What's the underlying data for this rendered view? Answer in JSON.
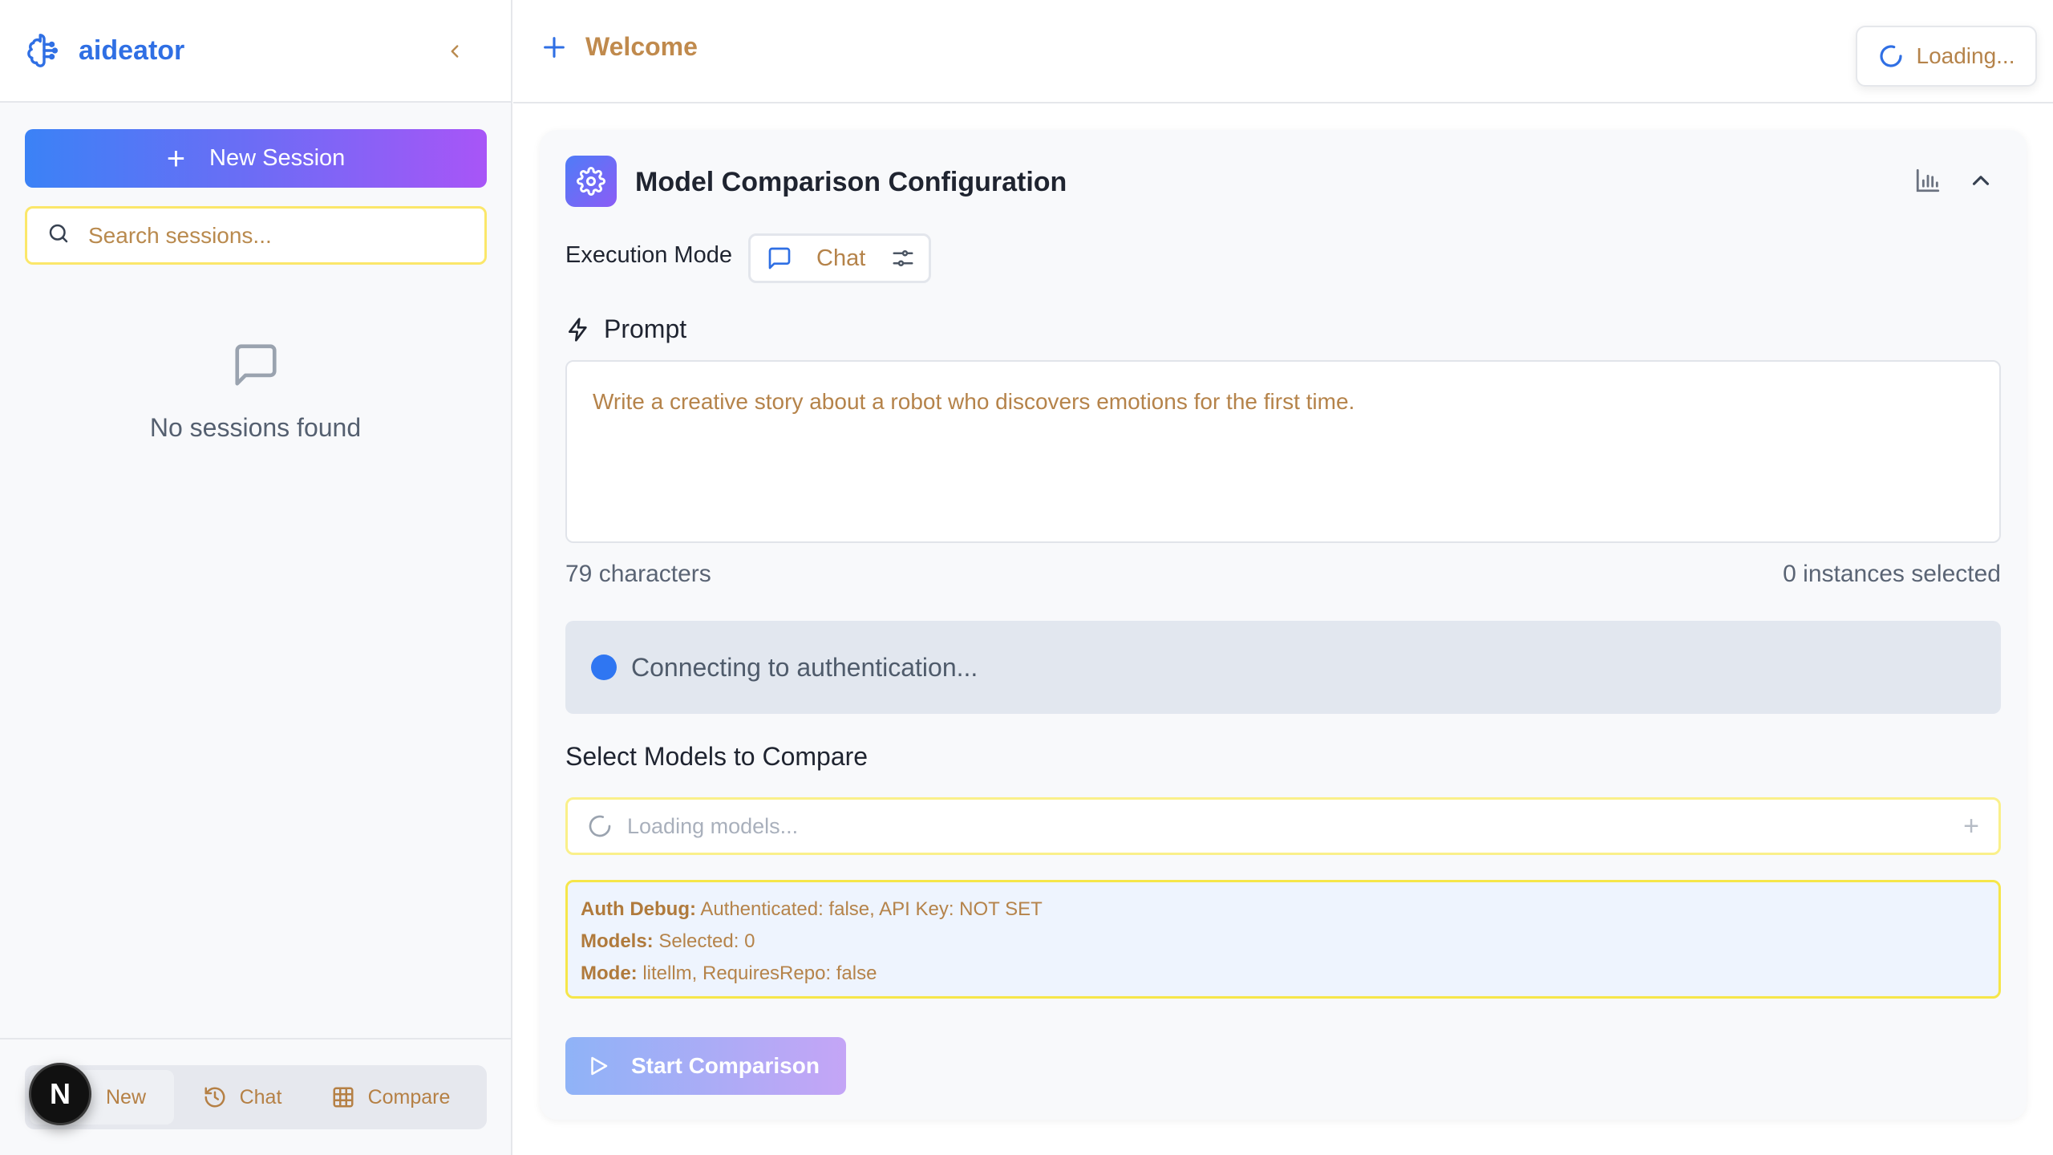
{
  "sidebar": {
    "brand": "aideator",
    "new_session_label": "New Session",
    "search_placeholder": "Search sessions...",
    "empty_text": "No sessions found",
    "tabs": {
      "new": "New",
      "chat": "Chat",
      "compare": "Compare"
    },
    "badge_letter": "N"
  },
  "topbar": {
    "welcome_label": "Welcome",
    "loading_label": "Loading..."
  },
  "card": {
    "title": "Model Comparison Configuration",
    "execution_mode_label": "Execution Mode",
    "execution_mode_value": "Chat",
    "prompt_label": "Prompt",
    "prompt_value": "Write a creative story about a robot who discovers emotions for the first time.",
    "char_count": "79 characters",
    "instances_selected": "0 instances selected",
    "connection_status": "Connecting to authentication...",
    "select_models_title": "Select Models to Compare",
    "models_loading": "Loading models...",
    "add_symbol": "+",
    "debug": {
      "auth_label": "Auth Debug:",
      "auth_value": "Authenticated: false, API Key: NOT SET",
      "models_label": "Models:",
      "models_value": "Selected: 0",
      "mode_label": "Mode:",
      "mode_value": "litellm, RequiresRepo: false"
    },
    "start_label": "Start Comparison"
  },
  "icons": {
    "brand": "brain-icon",
    "collapse": "chevron-left-icon",
    "search": "search-icon",
    "empty": "message-square-icon",
    "welcome": "plus-icon",
    "loading": "spinner-icon",
    "settings": "gear-icon",
    "chart": "bar-chart-icon",
    "collapse_card": "chevron-up-icon",
    "prompt": "lightning-icon",
    "play": "play-icon",
    "history": "history-icon",
    "grid": "grid-icon"
  },
  "colors": {
    "brand_blue": "#2f6fe4",
    "accent_purple": "#a855f7",
    "warm_text": "#b5834a",
    "highlight_yellow": "#f6e64a",
    "status_blue": "#2f76f2"
  }
}
